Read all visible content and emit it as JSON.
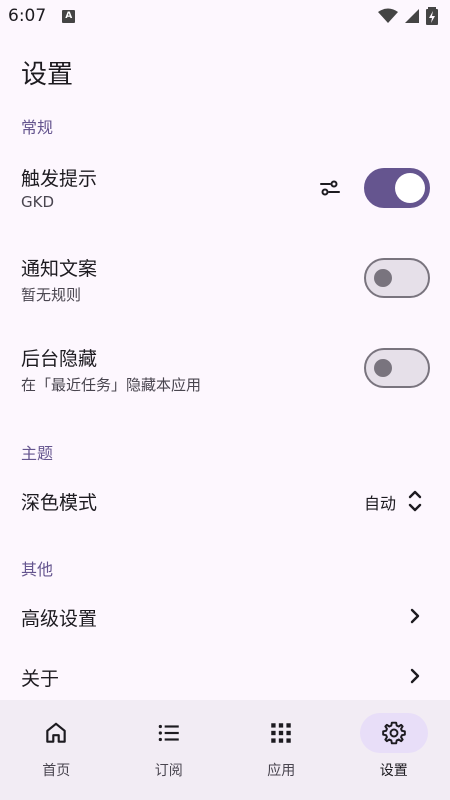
{
  "status_bar": {
    "time": "6:07",
    "notification_letter": "A"
  },
  "page": {
    "title": "设置"
  },
  "sections": {
    "general": "常规",
    "theme": "主题",
    "other": "其他"
  },
  "trigger_tip": {
    "title": "触发提示",
    "subtitle": "GKD",
    "enabled": true
  },
  "notify_text": {
    "title": "通知文案",
    "subtitle": "暂无规则",
    "enabled": false
  },
  "hide_background": {
    "title": "后台隐藏",
    "subtitle": "在「最近任务」隐藏本应用",
    "enabled": false
  },
  "dark_mode": {
    "title": "深色模式",
    "value": "自动"
  },
  "advanced": {
    "title": "高级设置"
  },
  "about": {
    "title": "关于"
  },
  "bottom_nav": {
    "home": "首页",
    "subscriptions": "订阅",
    "apps": "应用",
    "settings": "设置",
    "active": "settings"
  },
  "colors": {
    "background": "#fdf7fe",
    "accent": "#65558f",
    "nav_background": "#f2ecf4",
    "active_pill": "#e8def8"
  }
}
